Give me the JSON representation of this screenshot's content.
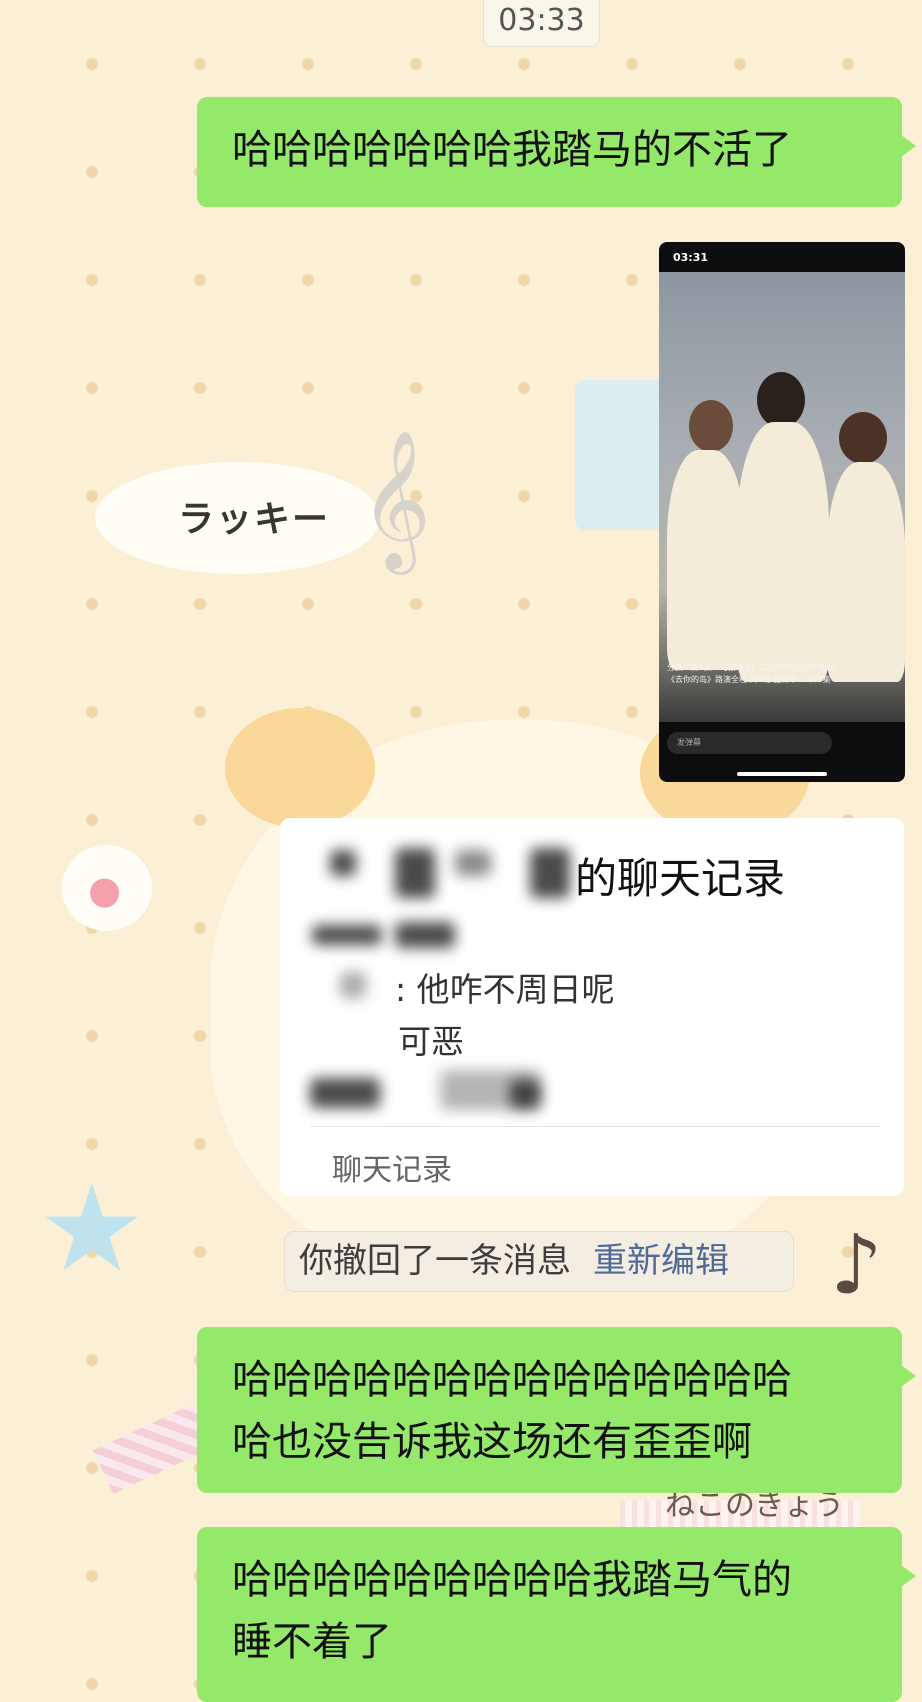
{
  "timestamp": "03:33",
  "wallpaper": {
    "cloud_text": "ラッキー",
    "clef_glyph": "𝄞",
    "note_glyph": "♪",
    "star_glyph": "★",
    "paw_glyph": "●",
    "neko_text": "ねこのきょう"
  },
  "messages": {
    "m1": "哈哈哈哈哈哈哈我踏马的不活了",
    "m2_line1": "哈哈哈哈哈哈哈哈哈哈哈哈哈哈",
    "m2_line2": "哈也没告诉我这场还有歪歪啊",
    "m3_line1": "哈哈哈哈哈哈哈哈哈我踏马气的",
    "m3_line2": "睡不着了"
  },
  "screenshot": {
    "status_time": "03:31",
    "caption_line1": "分集 · 第9集 · 【张瑞莲】20260801郑州 电影",
    "caption_line2": "《去你的岛》路演全程 共8场 更新中 13/19集",
    "input_placeholder": "发弹幕"
  },
  "chat_history": {
    "title_visible": "的聊天记录",
    "line1": ": 他咋不周日呢",
    "line2": "可恶",
    "footer": "聊天记录"
  },
  "recall_notice": {
    "text": "你撤回了一条消息",
    "link": "重新编辑"
  },
  "colors": {
    "bubble_green": "#94e96a",
    "background": "#fbefd6",
    "link_blue": "#4f6a96"
  }
}
